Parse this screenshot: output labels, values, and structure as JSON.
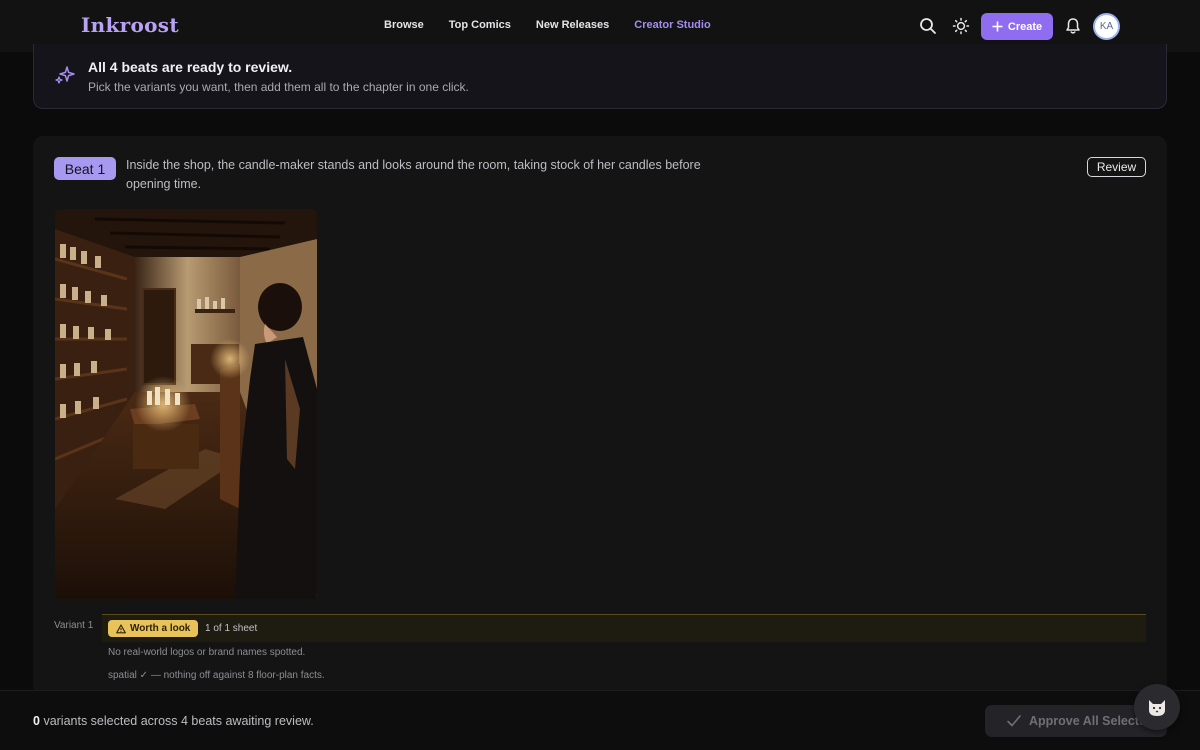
{
  "app": {
    "brand": "Inkroost"
  },
  "nav": {
    "items": [
      {
        "label": "Browse",
        "active": false
      },
      {
        "label": "Top Comics",
        "active": false
      },
      {
        "label": "New Releases",
        "active": false
      },
      {
        "label": "Creator Studio",
        "active": true
      }
    ]
  },
  "toolbar": {
    "search_icon": "search-icon",
    "theme_icon": "sun-icon",
    "create_label": "Create",
    "bell_icon": "bell-icon",
    "avatar_initials": "KA"
  },
  "banner": {
    "title": "All 4 beats are ready to review.",
    "subtitle": "Pick the variants you want, then add them all to the chapter in one click."
  },
  "beat": {
    "badge": "Beat 1",
    "description": "Inside the shop, the candle-maker stands and looks around the room, taking stock of her candles before opening time.",
    "review_label": "Review",
    "variant": {
      "label": "Variant 1",
      "status": "Worth a look",
      "sheet_count": "1 of 1 sheet",
      "notes": [
        "No real-world logos or brand names spotted.",
        "spatial ✓ — nothing off against 8 floor-plan facts."
      ]
    }
  },
  "footer": {
    "selected_count": "0",
    "summary_text": "variants selected across 4 beats awaiting review.",
    "approve_label": "Approve All Selected"
  },
  "colors": {
    "accent": "#8f6cf0",
    "accent_light": "#a58df0",
    "beat_badge": "#a798f0",
    "warning": "#e8c35a"
  }
}
